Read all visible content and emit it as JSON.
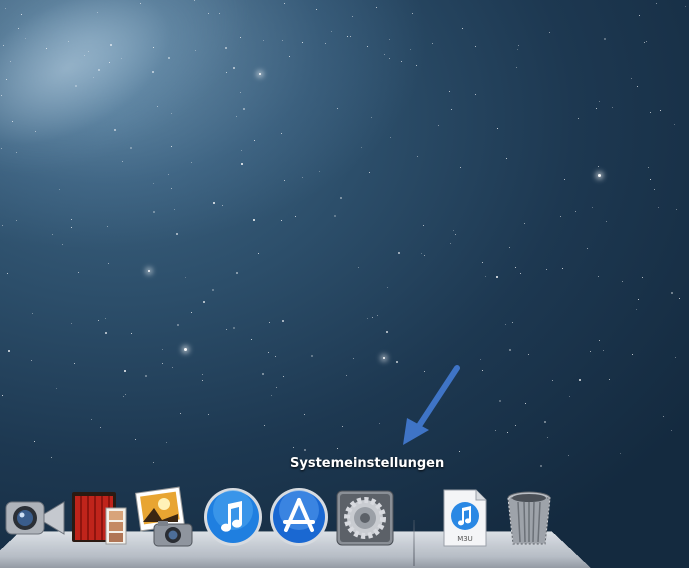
{
  "tooltip": {
    "label": "Systemeinstellungen"
  },
  "dock": {
    "items": [
      {
        "name": "FaceTime",
        "icon": "facetime-icon"
      },
      {
        "name": "Photo Booth",
        "icon": "photo-booth-icon"
      },
      {
        "name": "iPhoto",
        "icon": "iphoto-icon"
      },
      {
        "name": "iTunes",
        "icon": "itunes-icon"
      },
      {
        "name": "App Store",
        "icon": "app-store-icon"
      },
      {
        "name": "Systemeinstellungen",
        "icon": "system-preferences-icon"
      },
      {
        "name": "M3U",
        "icon": "m3u-file-icon"
      },
      {
        "name": "Papierkorb",
        "icon": "trash-icon"
      }
    ],
    "file_label": "M3U"
  },
  "colors": {
    "arrow": "#3f74c6",
    "itunes_blue": "#2c8ee8",
    "appstore_blue": "#1f6fd6"
  }
}
